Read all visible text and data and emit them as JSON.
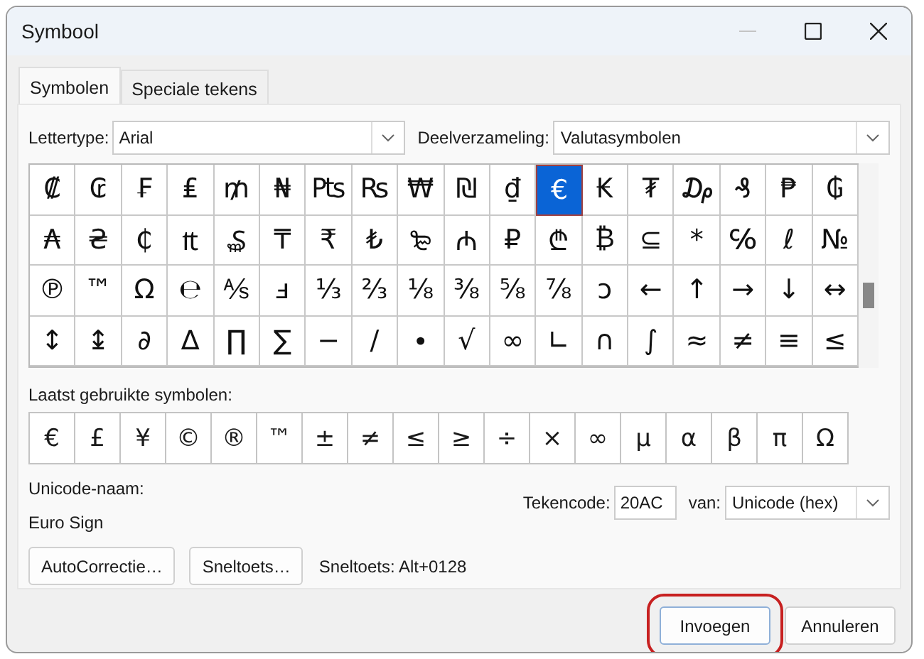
{
  "window": {
    "title": "Symbool"
  },
  "tabs": [
    {
      "label": "Symbolen",
      "selected": true
    },
    {
      "label": "Speciale tekens",
      "selected": false
    }
  ],
  "font": {
    "label": "Lettertype:",
    "value": "Arial"
  },
  "subset": {
    "label": "Deelverzameling:",
    "value": "Valutasymbolen"
  },
  "symbol_rows": [
    {
      "cells": [
        {
          "char": "₡",
          "selected": false
        },
        {
          "char": "₢",
          "selected": false
        },
        {
          "char": "₣",
          "selected": false
        },
        {
          "char": "₤",
          "selected": false
        },
        {
          "char": "₥",
          "selected": false
        },
        {
          "char": "₦",
          "selected": false
        },
        {
          "char": "₧",
          "selected": false
        },
        {
          "char": "₨",
          "selected": false
        },
        {
          "char": "₩",
          "selected": false
        },
        {
          "char": "₪",
          "selected": false
        },
        {
          "char": "₫",
          "selected": false
        },
        {
          "char": "€",
          "selected": true
        },
        {
          "char": "₭",
          "selected": false
        },
        {
          "char": "₮",
          "selected": false
        },
        {
          "char": "₯",
          "selected": false
        },
        {
          "char": "₰",
          "selected": false
        },
        {
          "char": "₱",
          "selected": false
        },
        {
          "char": "₲",
          "selected": false
        }
      ]
    },
    {
      "cells": [
        {
          "char": "₳",
          "selected": false
        },
        {
          "char": "₴",
          "selected": false
        },
        {
          "char": "₵",
          "selected": false
        },
        {
          "char": "₶",
          "selected": false
        },
        {
          "char": "₷",
          "selected": false
        },
        {
          "char": "₸",
          "selected": false
        },
        {
          "char": "₹",
          "selected": false
        },
        {
          "char": "₺",
          "selected": false
        },
        {
          "char": "₻",
          "selected": false
        },
        {
          "char": "₼",
          "selected": false
        },
        {
          "char": "₽",
          "selected": false
        },
        {
          "char": "₾",
          "selected": false
        },
        {
          "char": "₿",
          "selected": false
        },
        {
          "char": "⊆",
          "selected": false
        },
        {
          "char": "*",
          "selected": false
        },
        {
          "char": "℅",
          "selected": false
        },
        {
          "char": "ℓ",
          "selected": false
        },
        {
          "char": "№",
          "selected": false
        }
      ]
    },
    {
      "cells": [
        {
          "char": "℗",
          "selected": false
        },
        {
          "char": "™",
          "selected": false
        },
        {
          "char": "Ω",
          "selected": false
        },
        {
          "char": "℮",
          "selected": false
        },
        {
          "char": "⅍",
          "selected": false
        },
        {
          "char": "ⅎ",
          "selected": false
        },
        {
          "char": "⅓",
          "selected": false
        },
        {
          "char": "⅔",
          "selected": false
        },
        {
          "char": "⅛",
          "selected": false
        },
        {
          "char": "⅜",
          "selected": false
        },
        {
          "char": "⅝",
          "selected": false
        },
        {
          "char": "⅞",
          "selected": false
        },
        {
          "char": "ↄ",
          "selected": false
        },
        {
          "char": "←",
          "selected": false
        },
        {
          "char": "↑",
          "selected": false
        },
        {
          "char": "→",
          "selected": false
        },
        {
          "char": "↓",
          "selected": false
        },
        {
          "char": "↔",
          "selected": false
        }
      ]
    },
    {
      "cells": [
        {
          "char": "↕",
          "selected": false
        },
        {
          "char": "↨",
          "selected": false
        },
        {
          "char": "∂",
          "selected": false
        },
        {
          "char": "∆",
          "selected": false
        },
        {
          "char": "∏",
          "selected": false
        },
        {
          "char": "∑",
          "selected": false
        },
        {
          "char": "−",
          "selected": false
        },
        {
          "char": "∕",
          "selected": false
        },
        {
          "char": "∙",
          "selected": false
        },
        {
          "char": "√",
          "selected": false
        },
        {
          "char": "∞",
          "selected": false
        },
        {
          "char": "∟",
          "selected": false
        },
        {
          "char": "∩",
          "selected": false
        },
        {
          "char": "∫",
          "selected": false
        },
        {
          "char": "≈",
          "selected": false
        },
        {
          "char": "≠",
          "selected": false
        },
        {
          "char": "≡",
          "selected": false
        },
        {
          "char": "≤",
          "selected": false
        }
      ]
    }
  ],
  "recent": {
    "label": "Laatst gebruikte symbolen:",
    "symbols": [
      "€",
      "£",
      "¥",
      "©",
      "®",
      "™",
      "±",
      "≠",
      "≤",
      "≥",
      "÷",
      "×",
      "∞",
      "µ",
      "α",
      "β",
      "π",
      "Ω"
    ]
  },
  "unicode_name": {
    "label": "Unicode-naam:",
    "value": "Euro Sign"
  },
  "char_code": {
    "label": "Tekencode:",
    "value": "20AC"
  },
  "from": {
    "label": "van:",
    "value": "Unicode (hex)"
  },
  "panel_buttons": [
    {
      "label": "AutoCorrectie…"
    },
    {
      "label": "Sneltoets…"
    }
  ],
  "shortcut": "Sneltoets: Alt+0128",
  "dialog_buttons": [
    {
      "label": "Invoegen",
      "highlighted": true
    },
    {
      "label": "Annuleren",
      "highlighted": false
    }
  ]
}
